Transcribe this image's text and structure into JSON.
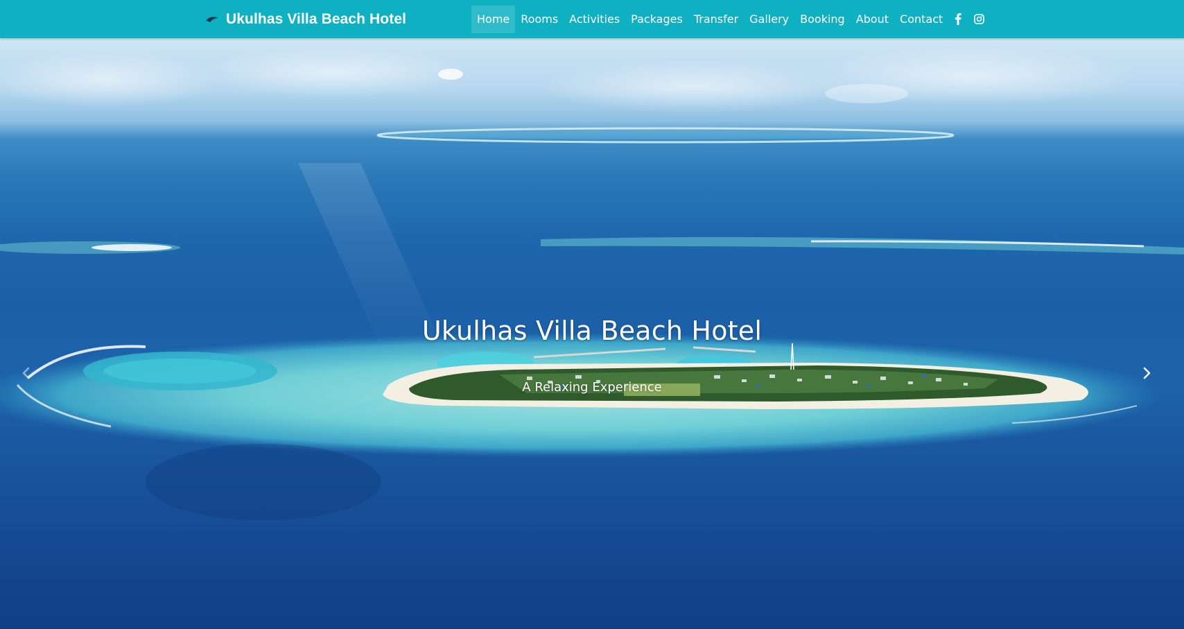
{
  "brand": {
    "name": "Ukulhas Villa Beach Hotel",
    "logo_icon": "whale-logo-icon"
  },
  "nav": {
    "items": [
      {
        "label": "Home",
        "active": true
      },
      {
        "label": "Rooms"
      },
      {
        "label": "Activities"
      },
      {
        "label": "Packages"
      },
      {
        "label": "Transfer"
      },
      {
        "label": "Gallery"
      },
      {
        "label": "Booking"
      },
      {
        "label": "About"
      },
      {
        "label": "Contact"
      }
    ],
    "social": [
      {
        "icon": "facebook-icon"
      },
      {
        "icon": "instagram-icon"
      }
    ]
  },
  "hero": {
    "title": "Ukulhas Villa Beach Hotel",
    "subtitle": "A Relaxing Experience",
    "prev_icon": "chevron-left-icon",
    "next_icon": "chevron-right-icon"
  },
  "colors": {
    "navbar": "#0fb0c2",
    "ocean_deep": "#113f86",
    "lagoon": "#7fd6dc",
    "text": "#ffffff"
  }
}
